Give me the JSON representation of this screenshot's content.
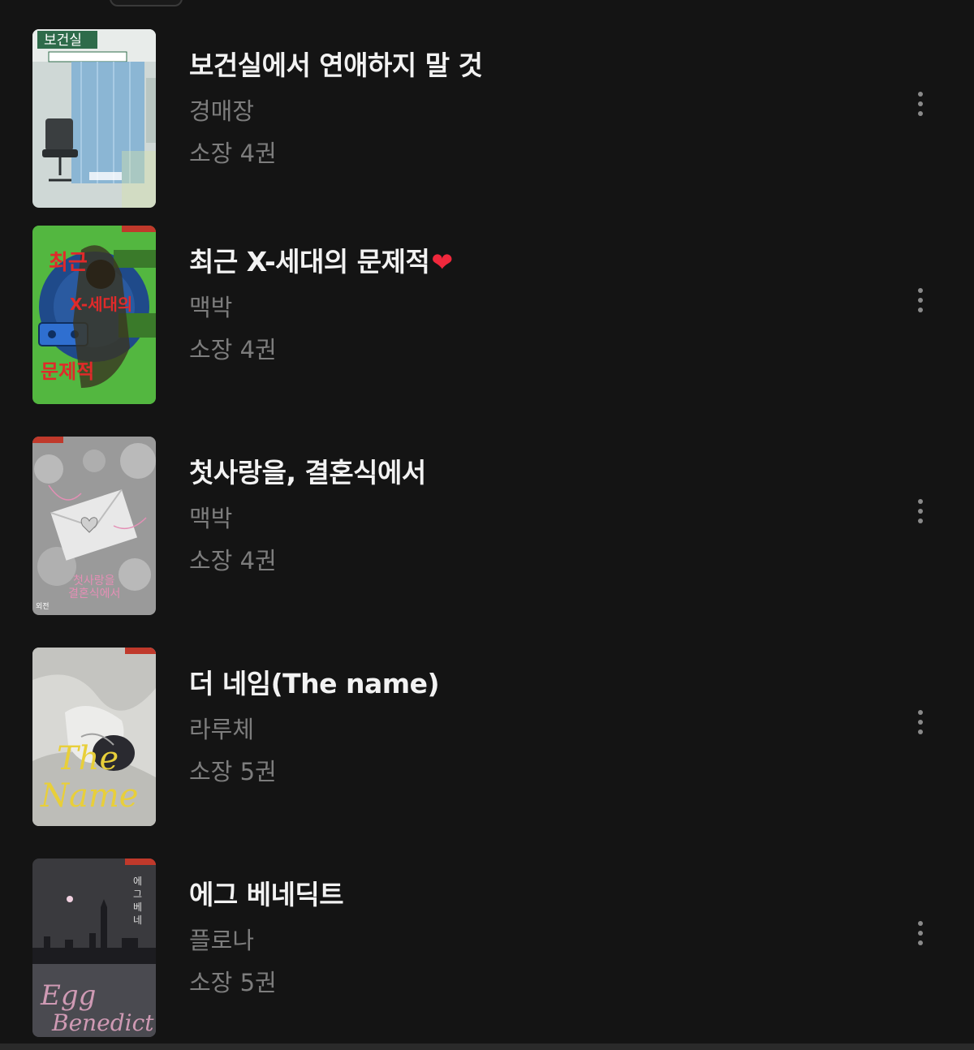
{
  "books": [
    {
      "title": "보건실에서 연애하지 말 것",
      "title_suffix": "",
      "author": "경매장",
      "owned": "소장 4권",
      "cover_icon": "book-cover-infirmary",
      "cover_text": "보건실",
      "cover_colors": {
        "bg": "#cfd8d6",
        "accent": "#7fb0d4",
        "text": "#2e6b4a"
      }
    },
    {
      "title": "최근 X-세대의 문제적",
      "title_suffix": "❤",
      "author": "맥박",
      "owned": "소장 4권",
      "cover_icon": "book-cover-x-generation",
      "cover_text": "최근 X-세대의 문제적",
      "cover_colors": {
        "bg": "#4caf3a",
        "accent": "#1f4a8a",
        "text": "#e02a2a"
      }
    },
    {
      "title": "첫사랑을, 결혼식에서",
      "title_suffix": "",
      "author": "맥박",
      "owned": "소장 4권",
      "cover_icon": "book-cover-first-love",
      "cover_text": "첫사랑을 결혼식에서",
      "cover_colors": {
        "bg": "#9a9a9a",
        "accent": "#e0e0e0",
        "text": "#e48fb5"
      }
    },
    {
      "title": "더 네임(The name)",
      "title_suffix": "",
      "author": "라루체",
      "owned": "소장 5권",
      "cover_icon": "book-cover-the-name",
      "cover_text": "The Name",
      "cover_colors": {
        "bg": "#d8d8d4",
        "accent": "#2a2a30",
        "text": "#e8cf3a"
      }
    },
    {
      "title": "에그 베네딕트",
      "title_suffix": "",
      "author": "플로나",
      "owned": "소장 5권",
      "cover_icon": "book-cover-egg-benedict",
      "cover_text": "Egg Benedict",
      "cover_colors": {
        "bg": "#3a3a3e",
        "accent": "#1c1c20",
        "text": "#e7a9c6"
      }
    }
  ],
  "more_icon": "more-vertical-icon"
}
